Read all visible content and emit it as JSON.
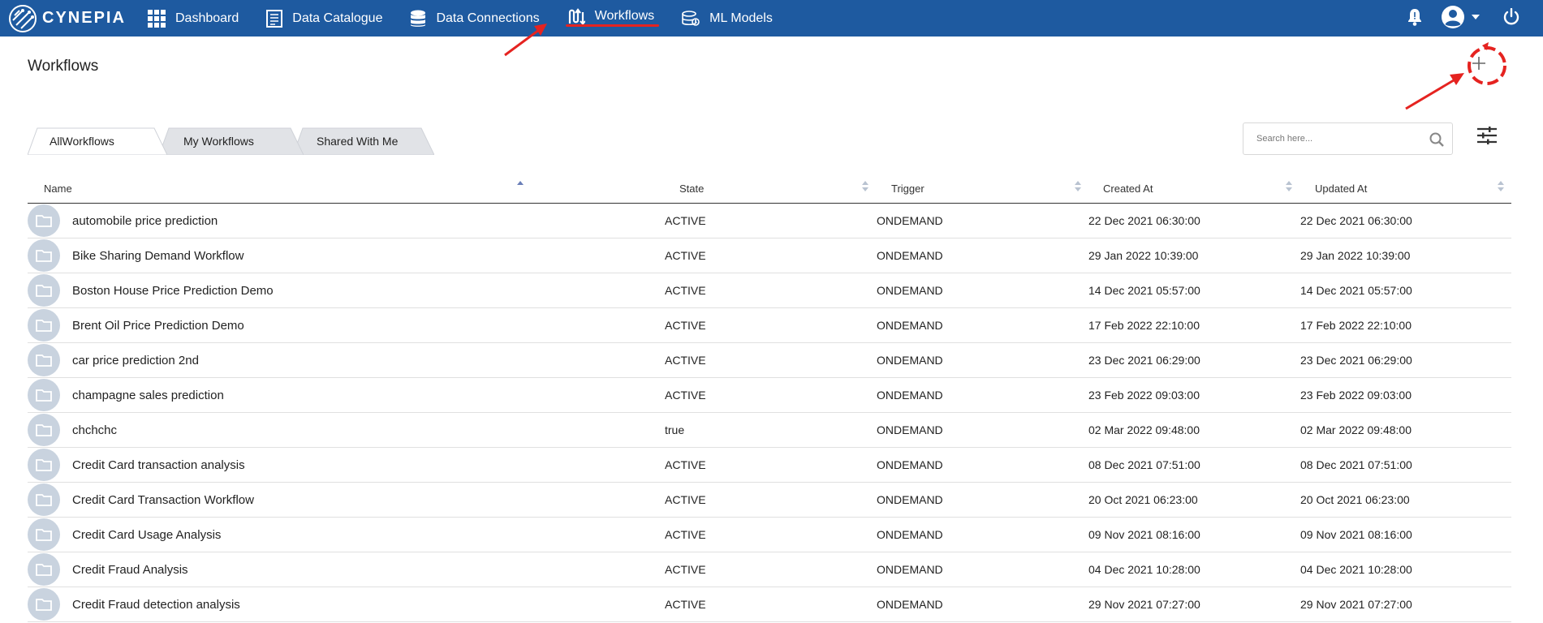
{
  "brand": {
    "name": "CYNEPIA"
  },
  "nav": {
    "items": [
      {
        "label": "Dashboard",
        "icon": "grid-icon"
      },
      {
        "label": "Data Catalogue",
        "icon": "catalogue-icon"
      },
      {
        "label": "Data Connections",
        "icon": "database-icon"
      },
      {
        "label": "Workflows",
        "icon": "workflow-icon",
        "active": true
      },
      {
        "label": "ML Models",
        "icon": "ml-models-icon"
      }
    ]
  },
  "header_icons": [
    "bell-icon",
    "user-avatar-icon",
    "caret-down-icon",
    "power-icon"
  ],
  "page": {
    "title": "Workflows"
  },
  "tabs": [
    {
      "label": "AllWorkflows",
      "active": true
    },
    {
      "label": "My Workflows"
    },
    {
      "label": "Shared With Me"
    }
  ],
  "search": {
    "placeholder": "Search here..."
  },
  "table": {
    "columns": [
      {
        "label": "Name"
      },
      {
        "label": "State"
      },
      {
        "label": "Trigger"
      },
      {
        "label": "Created At"
      },
      {
        "label": "Updated At"
      }
    ],
    "rows": [
      {
        "name": "automobile price prediction",
        "state": "ACTIVE",
        "trigger": "ONDEMAND",
        "created": "22 Dec 2021 06:30:00",
        "updated": "22 Dec 2021 06:30:00"
      },
      {
        "name": "Bike Sharing Demand Workflow",
        "state": "ACTIVE",
        "trigger": "ONDEMAND",
        "created": "29 Jan 2022 10:39:00",
        "updated": "29 Jan 2022 10:39:00"
      },
      {
        "name": "Boston House Price Prediction Demo",
        "state": "ACTIVE",
        "trigger": "ONDEMAND",
        "created": "14 Dec 2021 05:57:00",
        "updated": "14 Dec 2021 05:57:00"
      },
      {
        "name": "Brent Oil Price Prediction Demo",
        "state": "ACTIVE",
        "trigger": "ONDEMAND",
        "created": "17 Feb 2022 22:10:00",
        "updated": "17 Feb 2022 22:10:00"
      },
      {
        "name": "car price prediction 2nd",
        "state": "ACTIVE",
        "trigger": "ONDEMAND",
        "created": "23 Dec 2021 06:29:00",
        "updated": "23 Dec 2021 06:29:00"
      },
      {
        "name": "champagne sales prediction",
        "state": "ACTIVE",
        "trigger": "ONDEMAND",
        "created": "23 Feb 2022 09:03:00",
        "updated": "23 Feb 2022 09:03:00"
      },
      {
        "name": "chchchc",
        "state": "true",
        "trigger": "ONDEMAND",
        "created": "02 Mar 2022 09:48:00",
        "updated": "02 Mar 2022 09:48:00"
      },
      {
        "name": "Credit Card transaction analysis",
        "state": "ACTIVE",
        "trigger": "ONDEMAND",
        "created": "08 Dec 2021 07:51:00",
        "updated": "08 Dec 2021 07:51:00"
      },
      {
        "name": "Credit Card Transaction Workflow",
        "state": "ACTIVE",
        "trigger": "ONDEMAND",
        "created": "20 Oct 2021 06:23:00",
        "updated": "20 Oct 2021 06:23:00"
      },
      {
        "name": "Credit Card Usage Analysis",
        "state": "ACTIVE",
        "trigger": "ONDEMAND",
        "created": "09 Nov 2021 08:16:00",
        "updated": "09 Nov 2021 08:16:00"
      },
      {
        "name": "Credit Fraud Analysis",
        "state": "ACTIVE",
        "trigger": "ONDEMAND",
        "created": "04 Dec 2021 10:28:00",
        "updated": "04 Dec 2021 10:28:00"
      },
      {
        "name": "Credit Fraud detection analysis",
        "state": "ACTIVE",
        "trigger": "ONDEMAND",
        "created": "29 Nov 2021 07:27:00",
        "updated": "29 Nov 2021 07:27:00"
      }
    ]
  },
  "colors": {
    "nav_bg": "#1e5aa0",
    "accent_annotation": "#e52320",
    "folder_bg": "#c9d3df",
    "sort_icon": "#b9c3d1",
    "sort_active": "#6a7fb8"
  }
}
